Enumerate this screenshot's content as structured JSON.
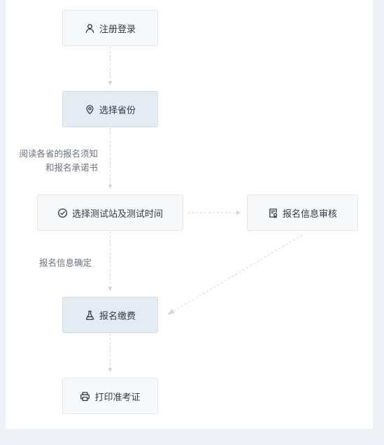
{
  "nodes": {
    "register": {
      "label": "注册登录",
      "icon": "user-icon"
    },
    "province": {
      "label": "选择省份",
      "icon": "location-pin-icon"
    },
    "site_time": {
      "label": "选择测试站及测试时间",
      "icon": "check-circle-icon"
    },
    "review": {
      "label": "报名信息审核",
      "icon": "document-review-icon"
    },
    "payment": {
      "label": "报名缴费",
      "icon": "flask-icon"
    },
    "print": {
      "label": "打印准考证",
      "icon": "printer-icon"
    }
  },
  "edge_labels": {
    "read_notice_line1": "阅读各省的报名须知",
    "read_notice_line2": "和报名承诺书",
    "confirm_info": "报名信息确定"
  },
  "colors": {
    "background": "#eef1f6",
    "panel": "#ffffff",
    "node_fill": "#f7f8fa",
    "node_highlight": "#e5ebf3",
    "text": "#333a44",
    "edge": "#d2d6dc"
  }
}
